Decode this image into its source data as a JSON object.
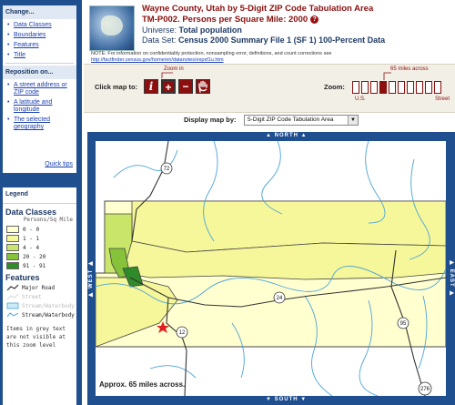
{
  "header": {
    "title_line1": "Wayne County, Utah by 5-Digit ZIP Code Tabulation Area",
    "title_line2": "TM-P002. Persons per Square Mile: 2000",
    "universe_label": "Universe:",
    "universe_value": "Total population",
    "dataset_label": "Data Set:",
    "dataset_value": "Census 2000 Summary File 1 (SF 1) 100-Percent Data",
    "note": "NOTE: For information on confidentiality protection, nonsampling error, definitions, and count corrections see",
    "note_url": "http://factfinder.census.gov/home/en/datanotes/expsf1u.htm",
    "help_glyph": "?"
  },
  "sidebar": {
    "change_heading": "Change...",
    "change_links": [
      "Data Classes",
      "Boundaries",
      "Features",
      "Title"
    ],
    "reposition_heading": "Reposition on...",
    "reposition_links": [
      "A street address or ZIP code",
      "A latitude and longitude",
      "The selected geography"
    ],
    "quick_tips": "Quick tips"
  },
  "legend": {
    "heading": "Legend",
    "data_classes_title": "Data Classes",
    "units": "Persons/Sq Mile",
    "classes": [
      {
        "label": "0 - 0",
        "color": "#ffffd0"
      },
      {
        "label": "1 - 1",
        "color": "#f6f79a"
      },
      {
        "label": "4 - 4",
        "color": "#c9e66a"
      },
      {
        "label": "20 - 20",
        "color": "#86c23a"
      },
      {
        "label": "91 - 91",
        "color": "#2f8a2a"
      }
    ],
    "features_title": "Features",
    "features": [
      "Major Road",
      "Street",
      "Stream/Waterbody",
      "Stream/Waterbody"
    ],
    "note": "Items in grey text are not visible at this zoom level"
  },
  "toolbar": {
    "click_map_to": "Click map to:",
    "zoom_in_label": "Zoom in",
    "zoom_label": "Zoom:",
    "zoom_scale_label": "65 miles across",
    "zoom_us": "U.S.",
    "zoom_street": "Street",
    "display_map_by": "Display map by:",
    "display_option": "5-Digit ZIP Code Tabulation Area"
  },
  "map": {
    "north": "NORTH",
    "south": "SOUTH",
    "east": "EAST",
    "west": "WEST",
    "approx": "Approx. 65 miles across.",
    "route_labels": [
      "72",
      "24",
      "12",
      "95",
      "276"
    ]
  },
  "colors": {
    "sidebar_bg": "#1f4f8f",
    "title_red": "#8b0f0f",
    "link_blue": "#1a3fb2",
    "road": "#333333",
    "water": "#4aa3d8"
  }
}
